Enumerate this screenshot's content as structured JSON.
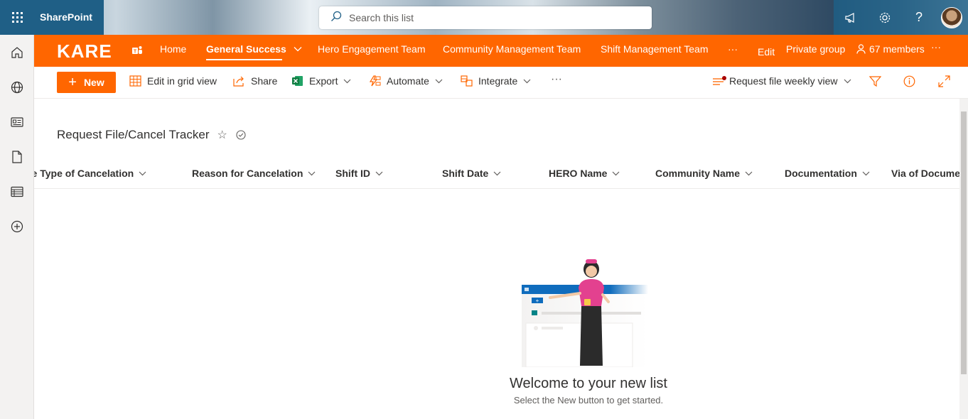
{
  "suite": {
    "app_name": "SharePoint",
    "search_placeholder": "Search this list"
  },
  "hub": {
    "logo": "KARE",
    "links": [
      {
        "label": "Home"
      },
      {
        "label": "General Success"
      },
      {
        "label": "Hero Engagement Team"
      },
      {
        "label": "Community Management Team"
      },
      {
        "label": "Shift Management Team"
      },
      {
        "label": "···"
      }
    ],
    "edit": "Edit",
    "private_group": "Private group",
    "members": "67 members",
    "more": "···"
  },
  "command_bar": {
    "new": "New",
    "edit_grid": "Edit in grid view",
    "share": "Share",
    "export": "Export",
    "automate": "Automate",
    "integrate": "Integrate",
    "more": "···",
    "view": "Request file weekly view"
  },
  "list": {
    "title": "Request File/Cancel Tracker",
    "columns": [
      "ne Type of Cancelation",
      "Reason for Cancelation",
      "Shift ID",
      "Shift Date",
      "HERO Name",
      "Community Name",
      "Documentation",
      "Via of Documen"
    ]
  },
  "empty_state": {
    "title": "Welcome to your new list",
    "subtitle": "Select the New button to get started."
  },
  "colors": {
    "brand_orange": "#ff6600",
    "suite_blue": "#1f5f86"
  }
}
